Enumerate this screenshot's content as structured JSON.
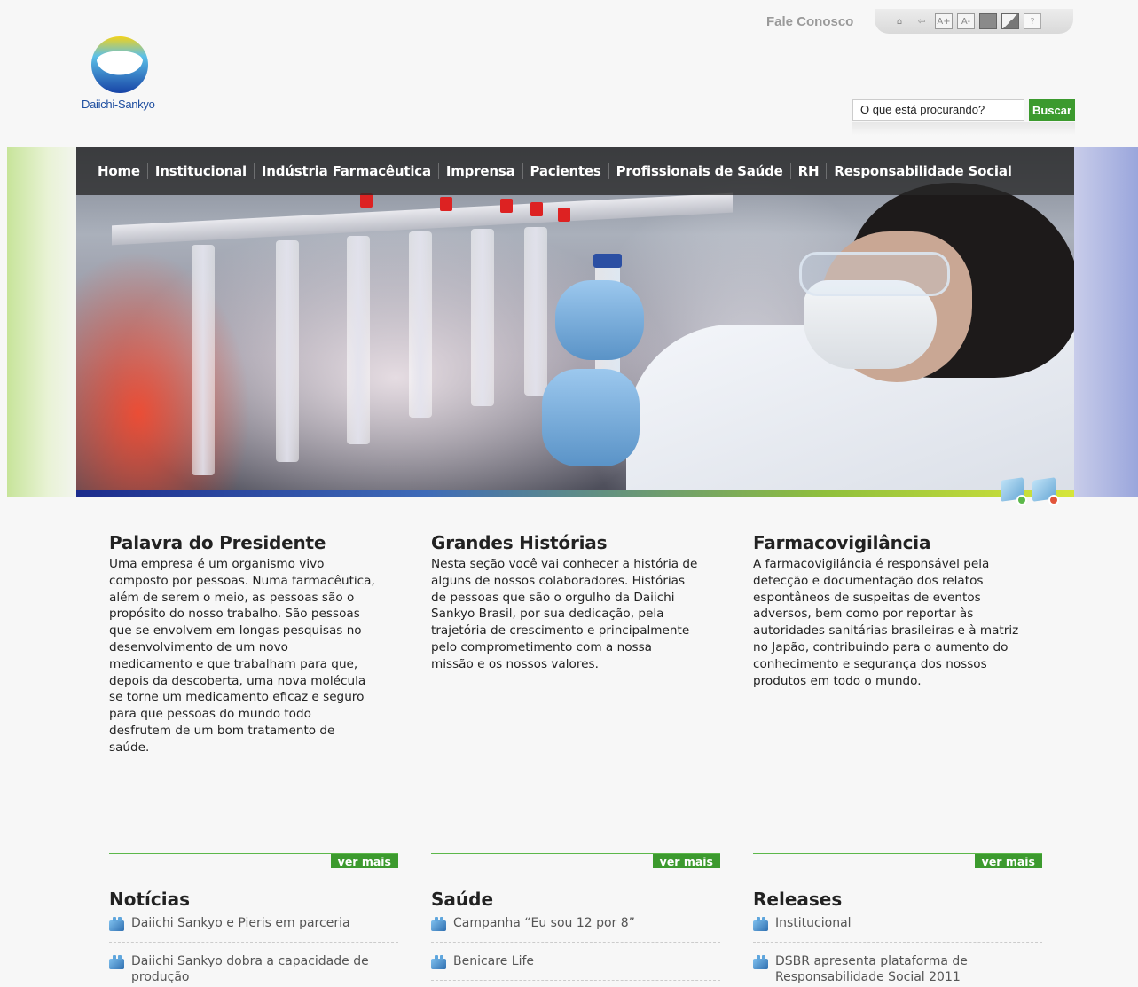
{
  "header": {
    "contact_label": "Fale Conosco",
    "tools": [
      {
        "icon": "home-icon",
        "glyph": "⌂"
      },
      {
        "icon": "back-arrow-icon",
        "glyph": "⇦"
      },
      {
        "icon": "font-increase-icon",
        "glyph": "A+"
      },
      {
        "icon": "font-decrease-icon",
        "glyph": "A-"
      },
      {
        "icon": "high-contrast-icon",
        "glyph": ""
      },
      {
        "icon": "contrast-toggle-icon",
        "glyph": ""
      },
      {
        "icon": "help-icon",
        "glyph": "?"
      }
    ],
    "logo_text": "Daiichi-Sankyo"
  },
  "search": {
    "value": "O que está procurando?",
    "button_label": "Buscar"
  },
  "nav": {
    "items": [
      "Home",
      "Institucional",
      "Indústria Farmacêutica",
      "Imprensa",
      "Pacientes",
      "Profissionais de Saúde",
      "RH",
      "Responsabilidade Social"
    ]
  },
  "colors": {
    "accent_green": "#3c9a2e",
    "nav_bg": "#2a2a2a",
    "link_gray": "#555555"
  },
  "columns": [
    {
      "title": "Palavra do Presidente",
      "lines": [
        "Uma empresa é um organismo vivo",
        "composto por pessoas. Numa farmacêutica,",
        "além de serem o meio, as pessoas são o",
        "propósito do nosso trabalho. São pessoas",
        "que se envolvem em longas pesquisas no",
        "desenvolvimento de um novo",
        "medicamento e que trabalham para que,",
        "depois da descoberta, uma nova molécula",
        "se torne um medicamento eficaz e seguro",
        "para que pessoas do mundo todo",
        "desfrutem de um bom tratamento de",
        "saúde."
      ],
      "more_label": "ver mais"
    },
    {
      "title": "Grandes Histórias",
      "lines": [
        "Nesta seção você vai conhecer a história de",
        "alguns de nossos colaboradores. Histórias",
        "de pessoas que são o orgulho da Daiichi",
        "Sankyo Brasil, por sua dedicação, pela",
        "trajetória de crescimento e principalmente",
        "pelo comprometimento com a nossa",
        "missão e os nossos valores."
      ],
      "more_label": "ver mais"
    },
    {
      "title": "Farmacovigilância",
      "lines": [
        "A farmacovigilância é responsável pela",
        "detecção e documentação dos relatos",
        "espontâneos de suspeitas de eventos",
        "adversos, bem como por reportar às",
        "autoridades sanitárias brasileiras e à matriz",
        "no Japão, contribuindo para o aumento do",
        "conhecimento e segurança dos nossos",
        "produtos em todo o mundo."
      ],
      "more_label": "ver mais"
    }
  ],
  "lists": [
    {
      "title": "Notícias",
      "items": [
        [
          "Daiichi Sankyo e Pieris em parceria"
        ],
        [
          "Daiichi Sankyo dobra a capacidade de",
          "produção"
        ]
      ]
    },
    {
      "title": "Saúde",
      "items": [
        [
          "Campanha “Eu sou 12 por 8”"
        ],
        [
          "Benicare Life"
        ]
      ]
    },
    {
      "title": "Releases",
      "items": [
        [
          "Institucional"
        ],
        [
          "DSBR apresenta plataforma de",
          "Responsabilidade Social 2011"
        ]
      ]
    }
  ]
}
